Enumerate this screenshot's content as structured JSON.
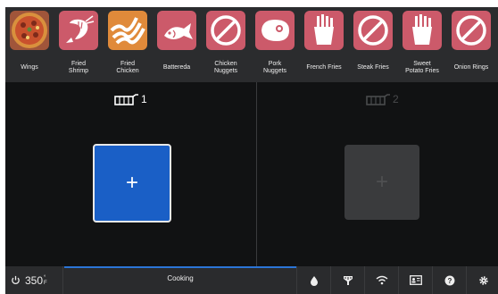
{
  "menu": {
    "items": [
      {
        "label": "Wings",
        "icon": "pizza-icon"
      },
      {
        "label": "Fried\nShrimp",
        "icon": "shrimp-icon"
      },
      {
        "label": "Fried\nChicken",
        "icon": "bacon-icon"
      },
      {
        "label": "Battereda",
        "icon": "fish-icon"
      },
      {
        "label": "Chicken\nNuggets",
        "icon": "no-symbol-icon"
      },
      {
        "label": "Pork\nNuggets",
        "icon": "steak-icon"
      },
      {
        "label": "French Fries",
        "icon": "fries-icon"
      },
      {
        "label": "Steak Fries",
        "icon": "no-symbol-icon"
      },
      {
        "label": "Sweet\nPotato Fries",
        "icon": "fries-icon"
      },
      {
        "label": "Onion Rings",
        "icon": "no-symbol-icon"
      }
    ]
  },
  "baskets": [
    {
      "number": "1",
      "action": "+"
    },
    {
      "number": "2",
      "action": "+"
    }
  ],
  "bottom": {
    "temperature": "350",
    "unit_icon": "fahrenheit",
    "status": "Cooking"
  },
  "colors": {
    "tile": "#cc5a6a",
    "wings_tile": "#a0553a",
    "chicken_tile": "#e08a3a",
    "accent": "#1a5fc6",
    "progress": "#2b74d6"
  }
}
